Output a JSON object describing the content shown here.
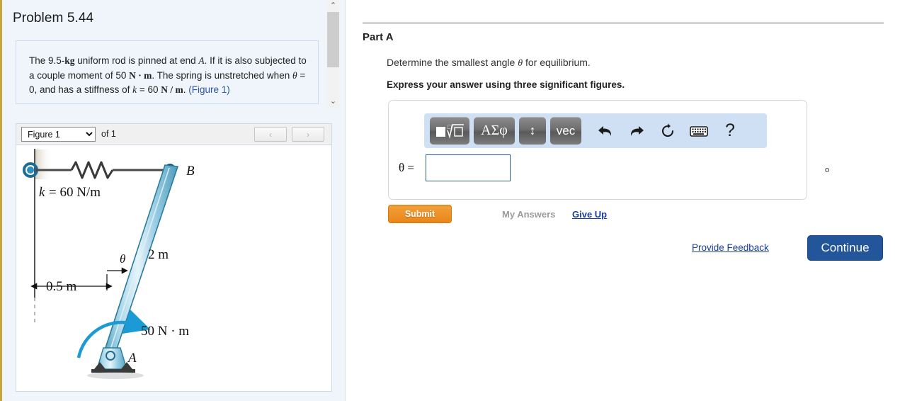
{
  "left": {
    "problem_title": "Problem 5.44",
    "problem_text_parts": {
      "p1": "The 9.5-",
      "kg": "kg",
      "p2": " uniform rod is pinned at end ",
      "A": "A",
      "p3": ". If it is also subjected to a couple moment of 50 ",
      "Nm": "N · m",
      "p4": ". The spring is unstretched when ",
      "theta": "θ",
      "p5": " = 0, and has a stiffness of ",
      "k": "k",
      "p6": " = 60 ",
      "Nperm": "N / m",
      "p7": ". ",
      "figure_link": "(Figure 1)"
    },
    "figure_selector": {
      "selected": "Figure 1",
      "options": [
        "Figure 1"
      ],
      "of_label": "of 1",
      "prev_label": "‹",
      "next_label": "›"
    },
    "scrollbar": {
      "up": "⌃",
      "down": "⌄"
    }
  },
  "figure": {
    "spring_label": "k = 60 N/m",
    "point_b": "B",
    "point_a": "A",
    "length_label": "2 m",
    "offset_label": "0.5 m",
    "theta_label": "θ",
    "moment_label": "50 N · m",
    "colors": {
      "rod_fill": "#8FC6DE",
      "rod_light": "#CFE8F2",
      "rod_stroke": "#2A7C9E",
      "arrow_blue": "#1C9AD6",
      "support_dark": "#3A3A3A"
    }
  },
  "right": {
    "part_title": "Part A",
    "question": {
      "pre": "Determine the smallest angle ",
      "theta": "θ",
      "post": " for equilibrium."
    },
    "instruction": "Express your answer using three significant figures.",
    "toolbar": {
      "buttons": [
        {
          "name": "template-root-button",
          "label": "■√□"
        },
        {
          "name": "greek-letters-button",
          "label": "ΑΣφ"
        },
        {
          "name": "move-cursor-button",
          "label": "↕"
        },
        {
          "name": "vector-button",
          "label": "vec"
        }
      ],
      "icons": [
        {
          "name": "undo-icon",
          "label": "↶"
        },
        {
          "name": "redo-icon",
          "label": "↷"
        },
        {
          "name": "reset-icon",
          "label": "↻"
        },
        {
          "name": "keyboard-icon",
          "label": "⌨"
        },
        {
          "name": "help-icon",
          "label": "?"
        }
      ]
    },
    "answer": {
      "theta_eq": "θ =",
      "value": "",
      "placeholder": "",
      "unit": "o"
    },
    "submit_label": "Submit",
    "my_answers_label": "My Answers",
    "give_up_label": "Give Up",
    "provide_feedback_label": "Provide Feedback",
    "continue_label": "Continue"
  }
}
